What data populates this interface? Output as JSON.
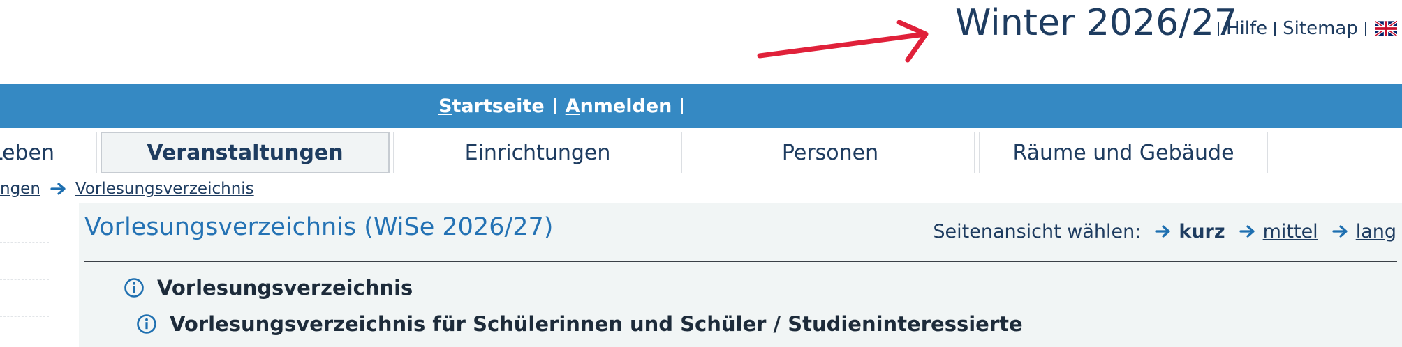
{
  "header": {
    "semester": "Winter 2026/27",
    "links": {
      "help": "Hilfe",
      "sitemap": "Sitemap"
    },
    "language_flag_icon": "uk-flag-icon",
    "annotation_arrow_color": "#e0213a"
  },
  "nav": {
    "home_first": "S",
    "home_rest": "tartseite",
    "login_first": "A",
    "login_rest": "nmelden",
    "bar_color": "#3589c3"
  },
  "tabs": [
    {
      "label": "Leben",
      "active": false
    },
    {
      "label": "Veranstaltungen",
      "active": true
    },
    {
      "label": "Einrichtungen",
      "active": false
    },
    {
      "label": "Personen",
      "active": false
    },
    {
      "label": "Räume und Gebäude",
      "active": false
    }
  ],
  "breadcrumb": {
    "items": [
      "ngen",
      "Vorlesungsverzeichnis"
    ]
  },
  "content": {
    "title": "Vorlesungsverzeichnis (WiSe 2026/27)",
    "view_select": {
      "label": "Seitenansicht wählen:",
      "options": [
        "kurz",
        "mittel",
        "lang"
      ],
      "current": "kurz"
    },
    "tree_items": [
      "Vorlesungsverzeichnis",
      "Vorlesungsverzeichnis für Schülerinnen und Schüler / Studieninteressierte"
    ]
  },
  "colors": {
    "text_dark": "#1e3c60",
    "title_blue": "#2472b4",
    "panel_bg": "#f1f5f5"
  }
}
